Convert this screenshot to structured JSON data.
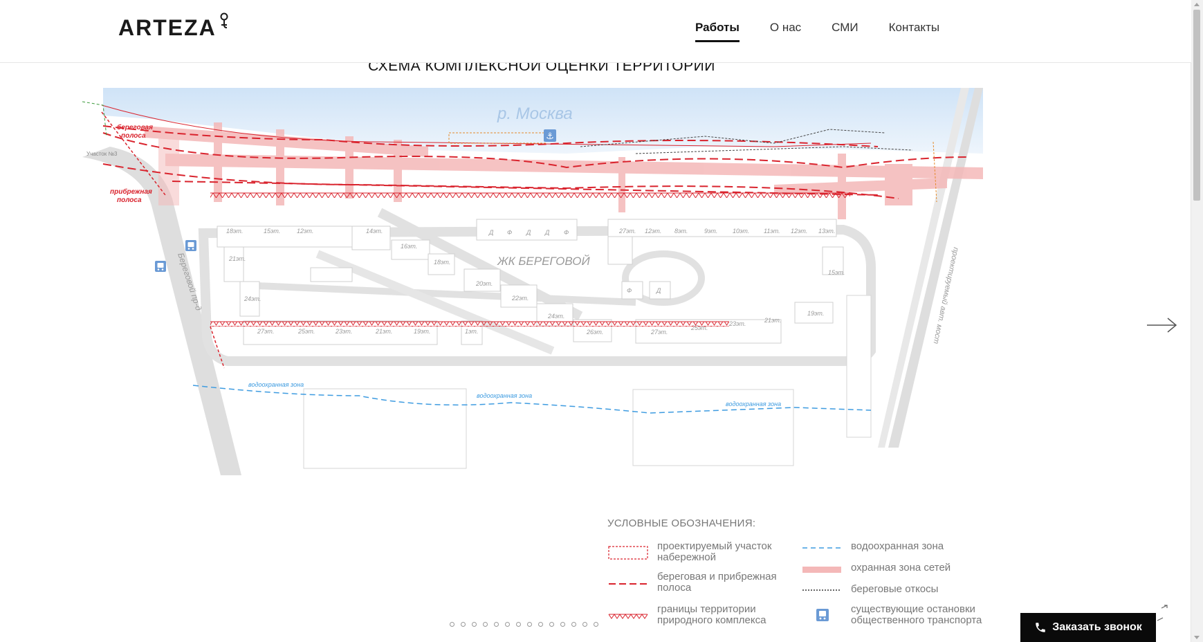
{
  "header": {
    "logo_text": "ARTEZA",
    "nav": [
      {
        "label": "Работы",
        "active": true
      },
      {
        "label": "О нас",
        "active": false
      },
      {
        "label": "СМИ",
        "active": false
      },
      {
        "label": "Контакты",
        "active": false
      }
    ]
  },
  "main": {
    "title": "СХЕМА КОМПЛЕКСНОЙ ОЦЕНКИ ТЕРРИТОРИИ"
  },
  "map": {
    "river_label": "р. Москва",
    "district_label": "ЖК БЕРЕГОВОЙ",
    "road_left_label": "Береговой пр-д",
    "bridge_label": "проектируемый авт. мост",
    "plot_label": "Участок №3",
    "shore_label_line1": "береговая",
    "shore_label_line2": "полоса",
    "near_shore_label_line1": "прибрежная",
    "near_shore_label_line2": "полоса",
    "water_zone_label": "водоохранная зона",
    "buildings_top": [
      "18эт.",
      "15эт.",
      "12эт.",
      "14эт.",
      "16эт.",
      "18эт."
    ],
    "buildings_mid": [
      "Д",
      "Ф",
      "Д",
      "Д",
      "Ф",
      "27эт.",
      "12эт.",
      "8эт.",
      "9эт.",
      "10эт.",
      "11эт.",
      "12эт.",
      "13эт."
    ],
    "buildings_other": [
      "21эт.",
      "24эт.",
      "20эт.",
      "22эт.",
      "24эт.",
      "26эт.",
      "15эт.",
      "Ф",
      "Д",
      "19эт.",
      "21эт."
    ],
    "buildings_bottom_left": [
      "27эт.",
      "25эт.",
      "23эт.",
      "21эт.",
      "19эт.",
      "1эт."
    ],
    "buildings_bottom_right": [
      "27эт.",
      "25эт.",
      "23эт."
    ],
    "colors": {
      "river": "#dbe9f8",
      "protection_zone": "#f4b8b8",
      "red_line": "#d9232d",
      "water_zone": "#3d9be0",
      "roads": "#dcdcdc"
    }
  },
  "legend": {
    "title": "УСЛОВНЫЕ ОБОЗНАЧЕНИЯ:",
    "items": [
      {
        "label": "проектируемый участок\nнабережной",
        "icon": "dotted-red-rect"
      },
      {
        "label": "береговая и прибрежная\nполоса",
        "icon": "dashed-red-line"
      },
      {
        "label": "границы территории\nприродного комплекса",
        "icon": "red-triangle-line"
      },
      {
        "label": "водоохранная зона",
        "icon": "dashed-blue-line"
      },
      {
        "label": "охранная зона сетей",
        "icon": "pink-band"
      },
      {
        "label": "береговые откосы",
        "icon": "dotted-black-line"
      },
      {
        "label": "существующие остановки\nобщественного транспорта",
        "icon": "bus-icon"
      }
    ]
  },
  "slider": {
    "dots_count": 14
  },
  "cta": {
    "call_label": "Заказать звонок"
  }
}
